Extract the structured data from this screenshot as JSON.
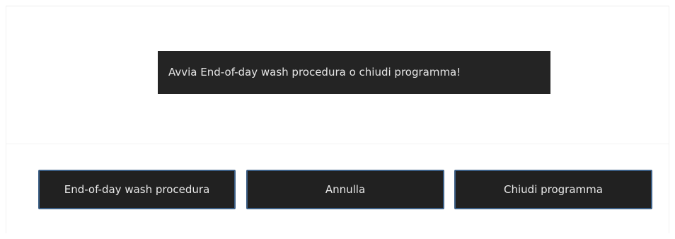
{
  "dialog": {
    "message": "Avvia End-of-day wash procedura o chiudi programma!",
    "buttons": {
      "wash_label": "End-of-day wash procedura",
      "cancel_label": "Annulla",
      "close_label": "Chiudi programma"
    }
  },
  "colors": {
    "button_background": "#212121",
    "button_border": "#3c5f86",
    "message_background": "#242424",
    "text": "#e6e6e6"
  }
}
